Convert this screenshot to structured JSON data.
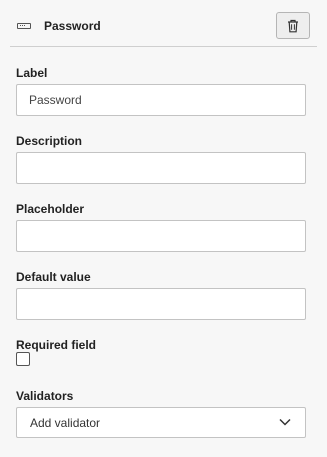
{
  "header": {
    "field_icon": "password-field-icon",
    "title": "Password",
    "delete_icon": "trash-icon"
  },
  "fields": {
    "label": {
      "label": "Label",
      "value": "Password"
    },
    "description": {
      "label": "Description",
      "value": ""
    },
    "placeholder": {
      "label": "Placeholder",
      "value": ""
    },
    "default_value": {
      "label": "Default value",
      "value": ""
    }
  },
  "required": {
    "label": "Required field",
    "checked": false
  },
  "validators": {
    "label": "Validators",
    "selected": "Add validator",
    "icon": "chevron-down-icon"
  }
}
